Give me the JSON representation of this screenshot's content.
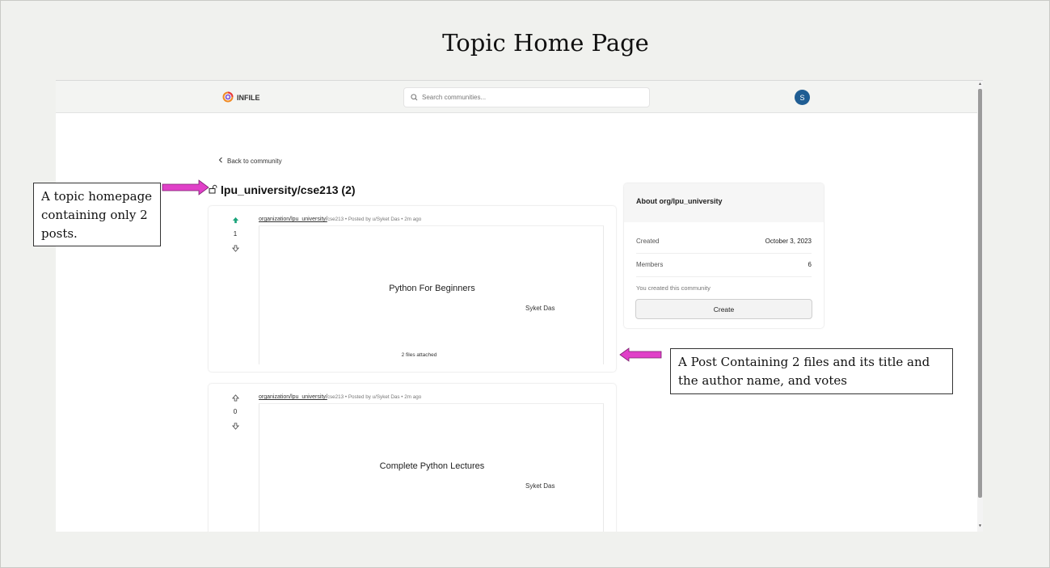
{
  "slide": {
    "title": "Topic Home Page"
  },
  "header": {
    "logo_text": "INFILE",
    "search_placeholder": "Search communities...",
    "avatar_initial": "S"
  },
  "nav": {
    "back_label": "Back to community"
  },
  "topic": {
    "title": "lpu_university/cse213 (2)"
  },
  "posts": [
    {
      "org_link": "organization/lpu_university/",
      "meta": "cse213 • Posted by u/Syket Das • 2m ago",
      "votes": "1",
      "upvoted": true,
      "title": "Python For Beginners",
      "author": "Syket Das",
      "files": "2 files attached"
    },
    {
      "org_link": "organization/lpu_university/",
      "meta": "cse213 • Posted by u/Syket Das • 2m ago",
      "votes": "0",
      "upvoted": false,
      "title": "Complete Python Lectures",
      "author": "Syket Das",
      "files": ""
    }
  ],
  "about": {
    "title": "About org/lpu_university",
    "created_label": "Created",
    "created_value": "October 3, 2023",
    "members_label": "Members",
    "members_value": "6",
    "note": "You created this community",
    "create_label": "Create"
  },
  "annotations": {
    "topic_note": "A topic homepage containing only 2 posts.",
    "post_note": "A Post Containing 2 files and its title and the author name, and votes"
  },
  "colors": {
    "accent": "#1f5d93",
    "upvote": "#1aa37a",
    "annotation_arrow": "#e040c8"
  },
  "icons": [
    "logo-icon",
    "search-icon",
    "chevron-left-icon",
    "lock-open-icon",
    "upvote-icon",
    "downvote-icon"
  ]
}
